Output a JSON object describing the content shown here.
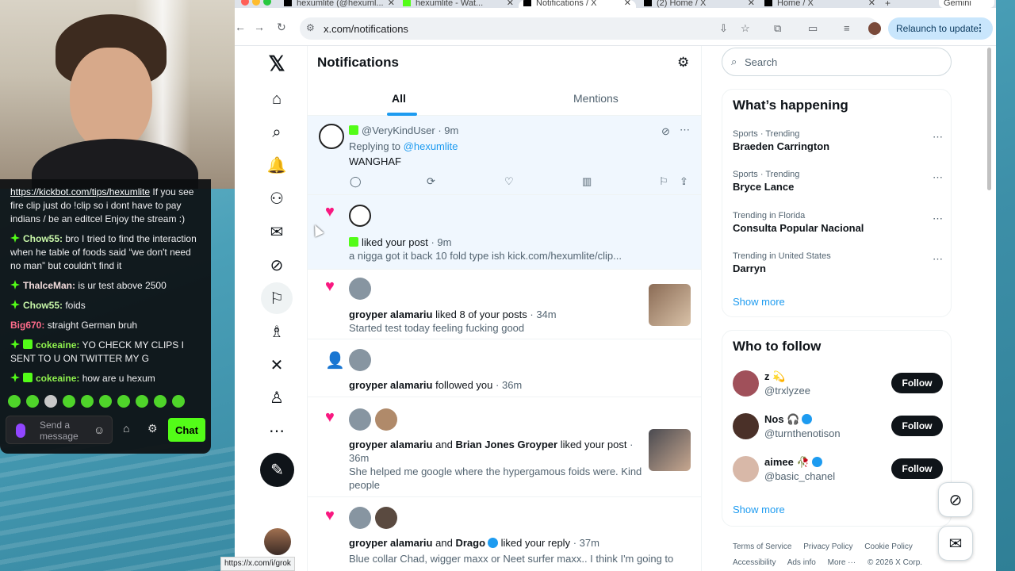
{
  "chat": {
    "messages": [
      {
        "user": "",
        "text": "https://kickbot.com/tips/hexumlite If you see fire clip just do !clip so i dont have to pay indians / be an editcel Enjoy the stream :)"
      },
      {
        "user": "Chow55:",
        "text": " bro I tried to find the interaction when he table of foods said “we don't need no man” but couldn't find it"
      },
      {
        "user": "ThalceMan:",
        "text": " is ur test above 2500"
      },
      {
        "user": "Chow55:",
        "text": " foids"
      },
      {
        "user": "Big670:",
        "text": " straight German bruh"
      },
      {
        "user": "cokeaine:",
        "text": " YO CHECK MY CLIPS I SENT TO U ON TWITTER MY G"
      },
      {
        "user": "cokeaine:",
        "text": " how are u hexum"
      }
    ],
    "input_placeholder": "Send a message",
    "send_label": "Chat",
    "colors": {
      "accent": "#53fc18"
    }
  },
  "browser": {
    "tabs": [
      "hexumlite (@hexuml...",
      "hexumlite - Wat...",
      "Notifications / X",
      "(2) Home / X",
      "Home / X",
      "Gemini"
    ],
    "url": "x.com/notifications",
    "relaunch_label": "Relaunch to update",
    "status_url": "https://x.com/i/grok"
  },
  "x": {
    "page_title": "Notifications",
    "tabs": {
      "all": "All",
      "mentions": "Mentions"
    },
    "notifications": {
      "reply": {
        "handle": "@VeryKindUser",
        "time": "· 9m",
        "replying_prefix": "Replying to ",
        "replying_to": "@hexumlite",
        "text": "WANGHAF"
      },
      "like1": {
        "action": "liked your post",
        "time": "· 9m",
        "text": "a nigga got it back 10 fold type ish kick.com/hexumlite/clip..."
      },
      "like2": {
        "name": "groyper alamariu",
        "action": "liked 8 of your posts",
        "time": "· 34m",
        "text": "Started test today feeling fucking good"
      },
      "follow": {
        "name": "groyper alamariu",
        "action": "followed you",
        "time": "· 36m"
      },
      "like3": {
        "name": "groyper alamariu",
        "and": "and",
        "name2": "Brian Jones Groyper",
        "action": "liked your post",
        "time": "·",
        "time2": "36m",
        "text": "She helped me google where the hypergamous foids were. Kind",
        "text2": "people"
      },
      "like4": {
        "name": "groyper alamariu",
        "and": "and",
        "name2": "Drago",
        "action": "liked your reply",
        "time": "· 37m",
        "text": "Blue collar Chad, wigger maxx or Neet surfer maxx.. I think I'm going to"
      }
    },
    "search_placeholder": "Search",
    "happening": {
      "title": "What’s happening",
      "trends": [
        {
          "meta": "Sports · Trending",
          "name": "Braeden Carrington"
        },
        {
          "meta": "Sports · Trending",
          "name": "Bryce Lance"
        },
        {
          "meta": "Trending in Florida",
          "name": "Consulta Popular Nacional"
        },
        {
          "meta": "Trending in United States",
          "name": "Darryn"
        }
      ],
      "show_more": "Show more"
    },
    "who_to_follow": {
      "title": "Who to follow",
      "users": [
        {
          "name": "z 💫",
          "handle": "@trxlyzee"
        },
        {
          "name": "Nos 🎧",
          "handle": "@turnthenotison"
        },
        {
          "name": "aimee 🥀",
          "handle": "@basic_chanel"
        }
      ],
      "follow_label": "Follow",
      "show_more": "Show more"
    },
    "footer": [
      "Terms of Service",
      "Privacy Policy",
      "Cookie Policy",
      "Accessibility",
      "Ads info",
      "More ···",
      "© 2026 X Corp."
    ],
    "colors": {
      "like": "#f91880",
      "link": "#1d9bf0"
    }
  }
}
